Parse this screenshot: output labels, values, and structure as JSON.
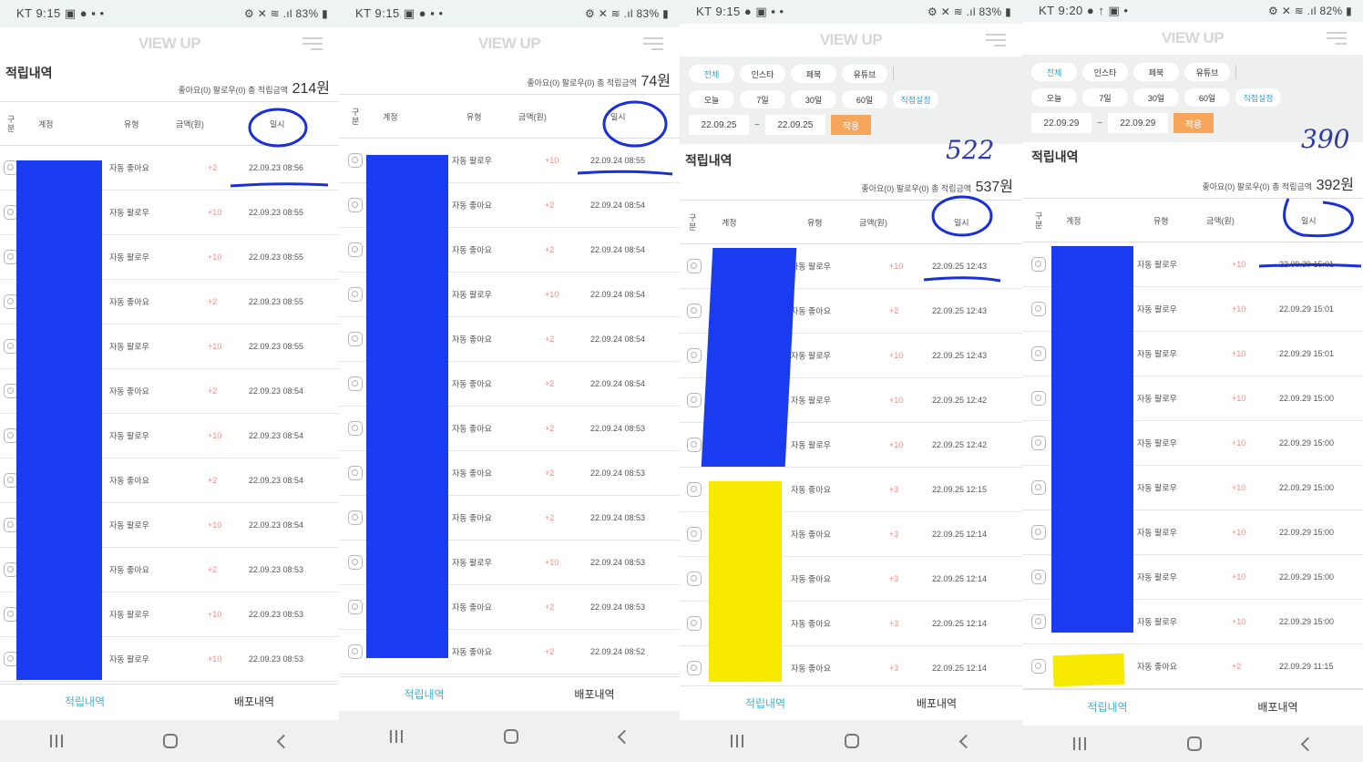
{
  "common": {
    "logo": "VIEW UP",
    "col_gubun": "구분",
    "col_account": "계정",
    "col_type": "유형",
    "col_amount": "금액(원)",
    "col_datetime": "일시",
    "section_title": "적립내역",
    "summary_text": "좋아요(0) 팔로우(0) 총 적립금액",
    "tab_earn": "적립내역",
    "tab_distribution": "배포내역",
    "filter_channels": [
      "전체",
      "인스타",
      "페북",
      "유튜브"
    ],
    "filter_periods": [
      "오늘",
      "7일",
      "30일",
      "60일"
    ],
    "filter_custom": "직접설정",
    "apply_label": "적용",
    "tilde": "~",
    "accent_color": "#3db4cf",
    "apply_color": "#f5a65b",
    "amount_color": "#f08c8c"
  },
  "panels": [
    {
      "status": {
        "left": "KT 9:15 ▣ ● ▪ •",
        "right": "⚙ ✕ ≋ .ıl 83% ▮"
      },
      "total": "214원",
      "rows": [
        {
          "type": "자동 좋아요",
          "amount": "+2",
          "datetime": "22.09.23 08:56"
        },
        {
          "type": "자동 팔로우",
          "amount": "+10",
          "datetime": "22.09.23 08:55"
        },
        {
          "type": "자동 팔로우",
          "amount": "+10",
          "datetime": "22.09.23 08:55"
        },
        {
          "type": "자동 좋아요",
          "amount": "+2",
          "datetime": "22.09.23 08:55"
        },
        {
          "type": "자동 팔로우",
          "amount": "+10",
          "datetime": "22.09.23 08:55"
        },
        {
          "type": "자동 좋아요",
          "amount": "+2",
          "datetime": "22.09.23 08:54"
        },
        {
          "type": "자동 팔로우",
          "amount": "+10",
          "datetime": "22.09.23 08:54"
        },
        {
          "type": "자동 좋아요",
          "amount": "+2",
          "datetime": "22.09.23 08:54"
        },
        {
          "type": "자동 팔로우",
          "amount": "+10",
          "datetime": "22.09.23 08:54"
        },
        {
          "type": "자동 좋아요",
          "amount": "+2",
          "datetime": "22.09.23 08:53"
        },
        {
          "type": "자동 팔로우",
          "amount": "+10",
          "datetime": "22.09.23 08:53"
        },
        {
          "type": "자동 팔로우",
          "amount": "+10",
          "datetime": "22.09.23 08:53"
        }
      ]
    },
    {
      "status": {
        "left": "KT 9:15 ▣ ● ▪ •",
        "right": "⚙ ✕ ≋ .ıl 83% ▮"
      },
      "total": "74원",
      "rows": [
        {
          "type": "자동 팔로우",
          "amount": "+10",
          "datetime": "22.09.24 08:55"
        },
        {
          "type": "자동 좋아요",
          "amount": "+2",
          "datetime": "22.09.24 08:54"
        },
        {
          "type": "자동 좋아요",
          "amount": "+2",
          "datetime": "22.09.24 08:54"
        },
        {
          "type": "자동 팔로우",
          "amount": "+10",
          "datetime": "22.09.24 08:54"
        },
        {
          "type": "자동 좋아요",
          "amount": "+2",
          "datetime": "22.09.24 08:54"
        },
        {
          "type": "자동 좋아요",
          "amount": "+2",
          "datetime": "22.09.24 08:54"
        },
        {
          "type": "자동 좋아요",
          "amount": "+2",
          "datetime": "22.09.24 08:53"
        },
        {
          "type": "자동 좋아요",
          "amount": "+2",
          "datetime": "22.09.24 08:53"
        },
        {
          "type": "자동 좋아요",
          "amount": "+2",
          "datetime": "22.09.24 08:53"
        },
        {
          "type": "자동 팔로우",
          "amount": "+10",
          "datetime": "22.09.24 08:53"
        },
        {
          "type": "자동 좋아요",
          "amount": "+2",
          "datetime": "22.09.24 08:53"
        },
        {
          "type": "자동 좋아요",
          "amount": "+2",
          "datetime": "22.09.24 08:52"
        }
      ]
    },
    {
      "status": {
        "left": "KT 9:15 ● ▣ ▪ •",
        "right": "⚙ ✕ ≋ .ıl 83% ▮"
      },
      "total": "537원",
      "date_from": "22.09.25",
      "date_to": "22.09.25",
      "handwritten": "522",
      "rows": [
        {
          "type": "자동 팔로우",
          "amount": "+10",
          "datetime": "22.09.25 12:43"
        },
        {
          "type": "자동 좋아요",
          "amount": "+2",
          "datetime": "22.09.25 12:43"
        },
        {
          "type": "자동 팔로우",
          "amount": "+10",
          "datetime": "22.09.25 12:43"
        },
        {
          "type": "자동 팔로우",
          "amount": "+10",
          "datetime": "22.09.25 12:42"
        },
        {
          "type": "자동 팔로우",
          "amount": "+10",
          "datetime": "22.09.25 12:42"
        },
        {
          "type": "자동 좋아요",
          "amount": "+3",
          "datetime": "22.09.25 12:15"
        },
        {
          "type": "자동 좋아요",
          "amount": "+3",
          "datetime": "22.09.25 12:14"
        },
        {
          "type": "자동 좋아요",
          "amount": "+3",
          "datetime": "22.09.25 12:14"
        },
        {
          "type": "자동 좋아요",
          "amount": "+3",
          "datetime": "22.09.25 12:14"
        },
        {
          "type": "자동 좋아요",
          "amount": "+3",
          "datetime": "22.09.25 12:14"
        }
      ]
    },
    {
      "status": {
        "left": "KT 9:20 ● ↑ ▣ •",
        "right": "⚙ ✕ ≋ .ıl 82% ▮"
      },
      "total": "392원",
      "date_from": "22.09.29",
      "date_to": "22.09.29",
      "handwritten": "390",
      "rows": [
        {
          "type": "자동 팔로우",
          "amount": "+10",
          "datetime": "22.09.29 15:01"
        },
        {
          "type": "자동 팔로우",
          "amount": "+10",
          "datetime": "22.09.29 15:01"
        },
        {
          "type": "자동 팔로우",
          "amount": "+10",
          "datetime": "22.09.29 15:01"
        },
        {
          "type": "자동 팔로우",
          "amount": "+10",
          "datetime": "22.09.29 15:00"
        },
        {
          "type": "자동 팔로우",
          "amount": "+10",
          "datetime": "22.09.29 15:00"
        },
        {
          "type": "자동 팔로우",
          "amount": "+10",
          "datetime": "22.09.29 15:00"
        },
        {
          "type": "자동 팔로우",
          "amount": "+10",
          "datetime": "22.09.29 15:00"
        },
        {
          "type": "자동 팔로우",
          "amount": "+10",
          "datetime": "22.09.29 15:00"
        },
        {
          "type": "자동 팔로우",
          "amount": "+10",
          "datetime": "22.09.29 15:00"
        },
        {
          "type": "자동 좋아요",
          "amount": "+2",
          "datetime": "22.09.29 11:15"
        }
      ]
    }
  ]
}
